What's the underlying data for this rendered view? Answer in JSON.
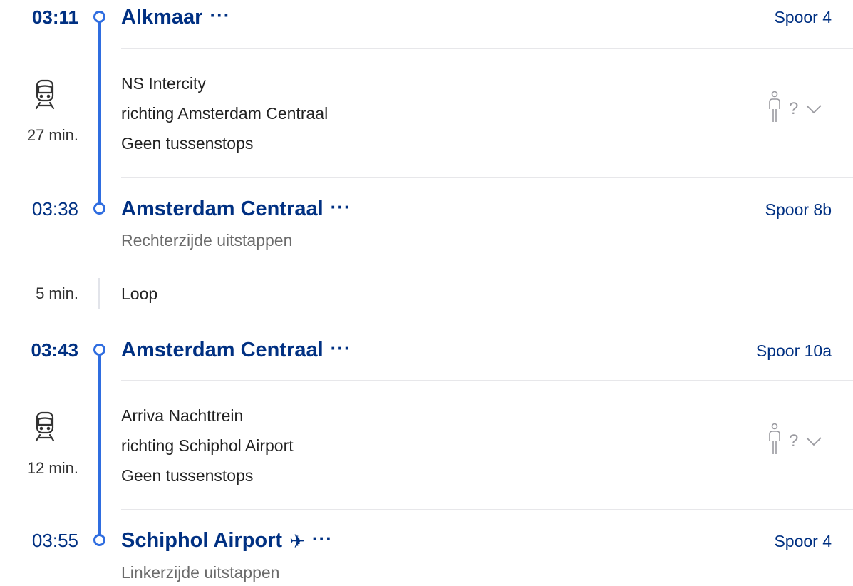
{
  "legs": [
    {
      "departure": {
        "time": "03:11",
        "station": "Alkmaar",
        "more": "···",
        "platform": "Spoor 4"
      },
      "train": {
        "icon": "train-icon",
        "duration": "27 min.",
        "operator": "NS Intercity",
        "direction": "richting Amsterdam Centraal",
        "stops": "Geen tussenstops",
        "occupancy_icon": "person-icon",
        "occupancy_value": "?",
        "expand_icon": "chevron-down-icon"
      },
      "arrival": {
        "time": "03:38",
        "station": "Amsterdam Centraal",
        "more": "···",
        "platform": "Spoor 8b",
        "note": "Rechterzijde uitstappen"
      }
    },
    {
      "departure": {
        "time": "03:43",
        "station": "Amsterdam Centraal",
        "more": "···",
        "platform": "Spoor 10a"
      },
      "train": {
        "icon": "train-icon",
        "duration": "12 min.",
        "operator": "Arriva Nachttrein",
        "direction": "richting Schiphol Airport",
        "stops": "Geen tussenstops",
        "occupancy_icon": "person-icon",
        "occupancy_value": "?",
        "expand_icon": "chevron-down-icon"
      },
      "arrival": {
        "time": "03:55",
        "station": "Schiphol Airport",
        "station_icon": "plane-icon",
        "station_icon_glyph": "✈",
        "more": "···",
        "platform": "Spoor 4",
        "note": "Linkerzijde uitstappen"
      }
    }
  ],
  "transfer": {
    "duration": "5 min.",
    "label": "Loop"
  },
  "colors": {
    "brand_blue": "#003082",
    "line_blue": "#2f6de0",
    "separator": "#e7e7ea",
    "muted_text": "#6b6b6b"
  }
}
